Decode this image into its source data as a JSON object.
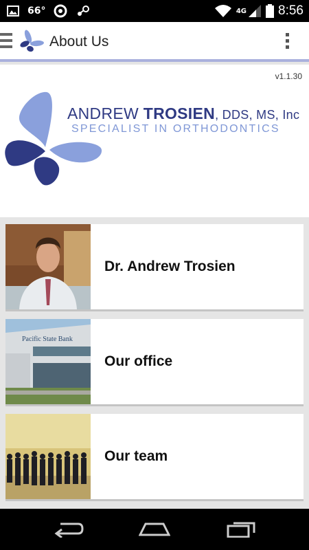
{
  "status": {
    "temp": "66°",
    "network": "4G",
    "time": "8:56"
  },
  "appbar": {
    "title": "About Us"
  },
  "banner": {
    "version": "v1.1.30",
    "name_first": "ANDREW ",
    "name_last": "TROSIEN",
    "credentials": ", DDS, MS, Inc",
    "tagline": "SPECIALIST IN ORTHODONTICS"
  },
  "items": [
    {
      "label": "Dr. Andrew Trosien"
    },
    {
      "label": "Our office",
      "sign": "Pacific State Bank"
    },
    {
      "label": "Our team"
    }
  ],
  "colors": {
    "brand_dark": "#2f3a83",
    "brand_light": "#8aa0dc",
    "accent_bar": "#aab1dd"
  }
}
